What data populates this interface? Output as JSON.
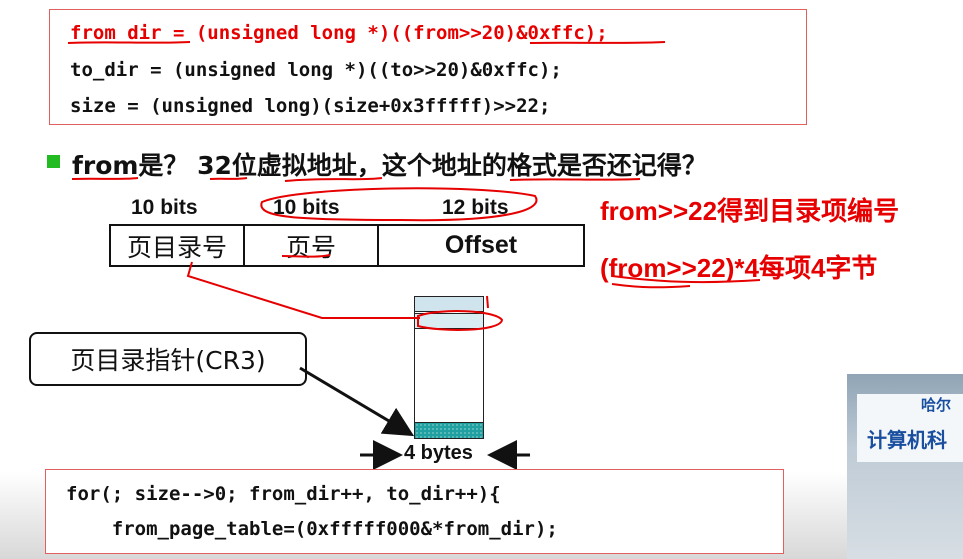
{
  "code_top": {
    "lines": [
      {
        "prefix": "from_dir = (unsigned long *)((from>>20)&0xffc);",
        "is_red": true
      },
      {
        "prefix": "to_dir = (unsigned long *)((to>>20)&0xffc);",
        "is_red": false
      },
      {
        "prefix": "size = (unsigned long)(size+0x3fffff)>>22;",
        "is_red": false
      }
    ]
  },
  "question": "from是？ 32位虚拟地址，这个地址的格式是否还记得？",
  "bit_labels": [
    "10 bits",
    "10 bits",
    "12 bits"
  ],
  "address_fields": [
    "页目录号",
    "页号",
    "Offset"
  ],
  "notes": {
    "line1": "from>>22得到目录项编号",
    "line2": "(from>>22)*4每项4字节"
  },
  "cr3_label": "页目录指针(CR3)",
  "entry_size_label": "4 bytes",
  "code_bottom": {
    "line1": "for(; size-->0; from_dir++, to_dir++){",
    "line2": "    from_page_table=(0xfffff000&*from_dir);"
  },
  "video_overlay": {
    "line1": "哈尔",
    "line2": "计算机科"
  },
  "colors": {
    "accent_red": "#e60000",
    "bullet_green": "#22bb22",
    "teal_fill": "#20a0a0",
    "light_blue_fill": "#cfe4ec"
  }
}
